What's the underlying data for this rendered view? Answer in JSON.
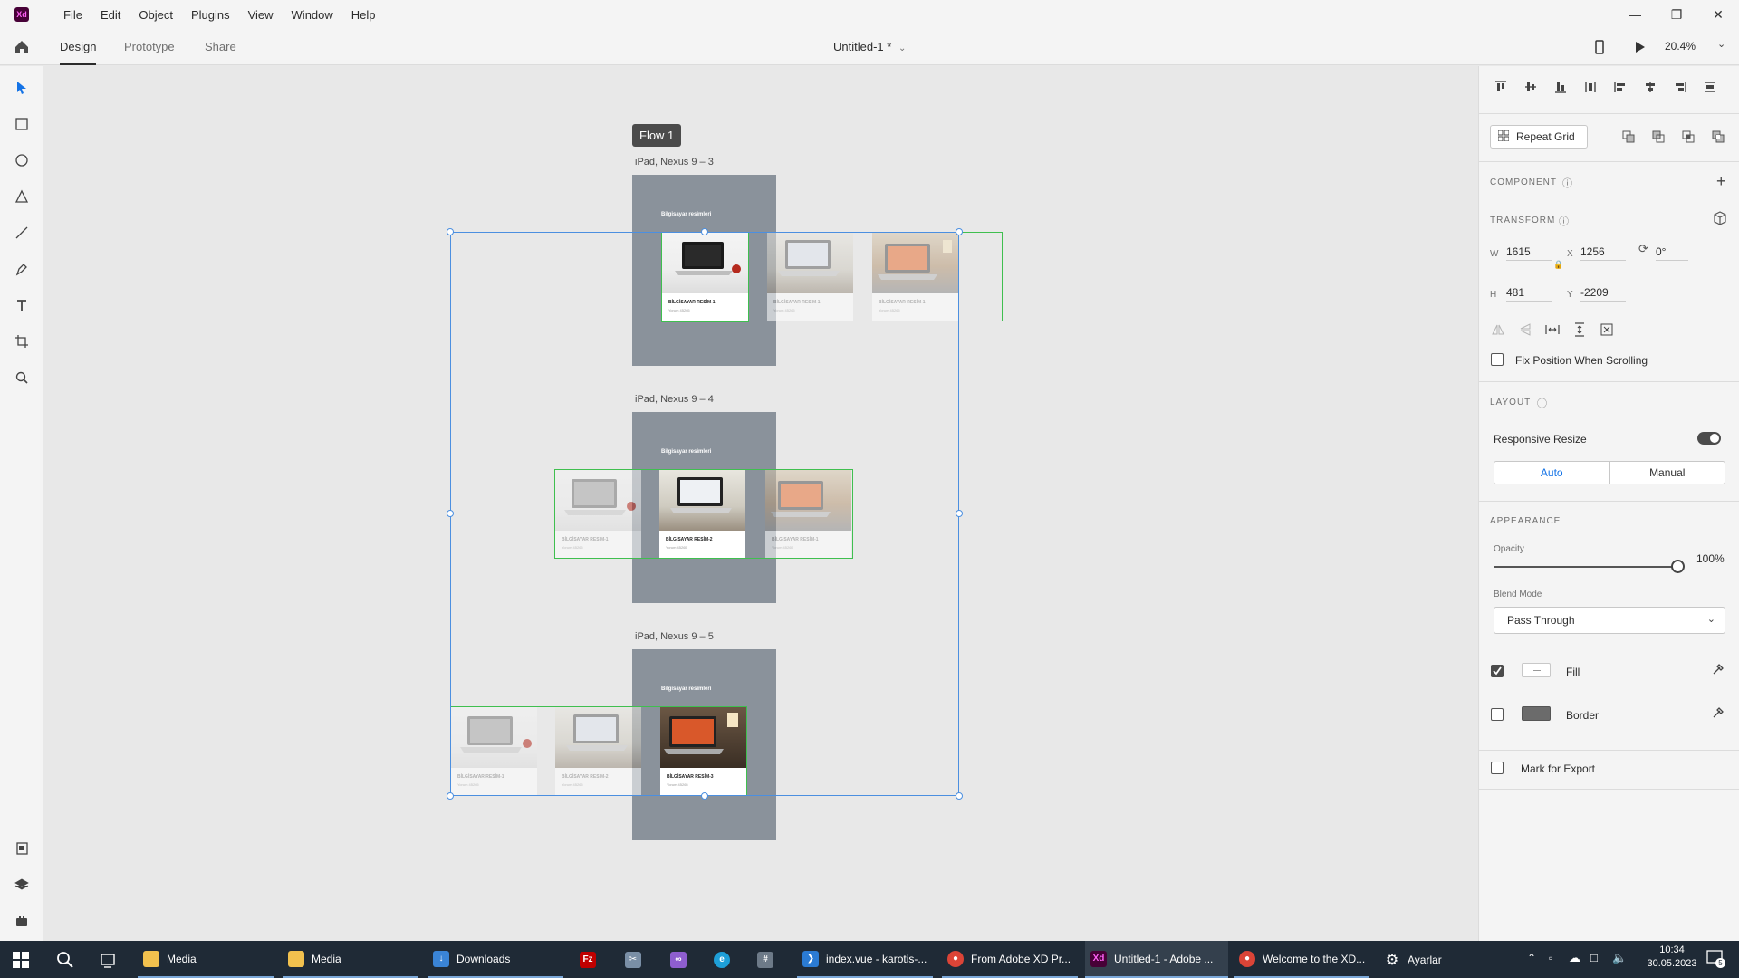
{
  "app": {
    "logo": "Xd",
    "doc_title": "Untitled-1 *",
    "zoom": "20.4%"
  },
  "menu": [
    "File",
    "Edit",
    "Object",
    "Plugins",
    "View",
    "Window",
    "Help"
  ],
  "modes": {
    "design": "Design",
    "prototype": "Prototype",
    "share": "Share"
  },
  "canvas": {
    "flow_label": "Flow 1",
    "artboards": [
      {
        "name": "iPad, Nexus 9 – 3",
        "title": "Bilgisayar resimleri"
      },
      {
        "name": "iPad, Nexus 9 – 4",
        "title": "Bilgisayar resimleri"
      },
      {
        "name": "iPad, Nexus 9 – 5",
        "title": "Bilgisayar resimleri"
      }
    ],
    "cards": {
      "c1": "BİLGİSAYAR RESİM-1",
      "c2": "BİLGİSAYAR RESİM-2",
      "c3": "BİLGİSAYAR RESİM-3",
      "sub": "Yorum 45265"
    }
  },
  "panel": {
    "repeat_grid": "Repeat Grid",
    "component": "COMPONENT",
    "transform": "TRANSFORM",
    "w_label": "W",
    "w": "1615",
    "x_label": "X",
    "x": "1256",
    "rot": "0°",
    "h_label": "H",
    "h": "481",
    "y_label": "Y",
    "y": "-2209",
    "fix_position": "Fix Position When Scrolling",
    "layout": "LAYOUT",
    "responsive": "Responsive Resize",
    "auto": "Auto",
    "manual": "Manual",
    "appearance": "APPEARANCE",
    "opacity_label": "Opacity",
    "opacity": "100%",
    "opacity_value": 1.0,
    "blend_label": "Blend Mode",
    "blend": "Pass Through",
    "fill": "Fill",
    "border": "Border",
    "mark_export": "Mark for Export"
  },
  "taskbar": {
    "apps": [
      {
        "label": "Media"
      },
      {
        "label": "Media"
      },
      {
        "label": "Downloads"
      },
      {
        "label": "index.vue - karotis-..."
      },
      {
        "label": "From Adobe XD Pr..."
      },
      {
        "label": "Untitled-1 - Adobe ..."
      },
      {
        "label": "Welcome to the XD..."
      },
      {
        "label": "Ayarlar"
      }
    ],
    "time": "10:34",
    "date": "30.05.2023",
    "notif": "5"
  },
  "colors": {
    "accent": "#1473e6",
    "selection": "#4b8fe0",
    "repeat_green": "#3fbf4f",
    "xd_brand": "#470137"
  }
}
